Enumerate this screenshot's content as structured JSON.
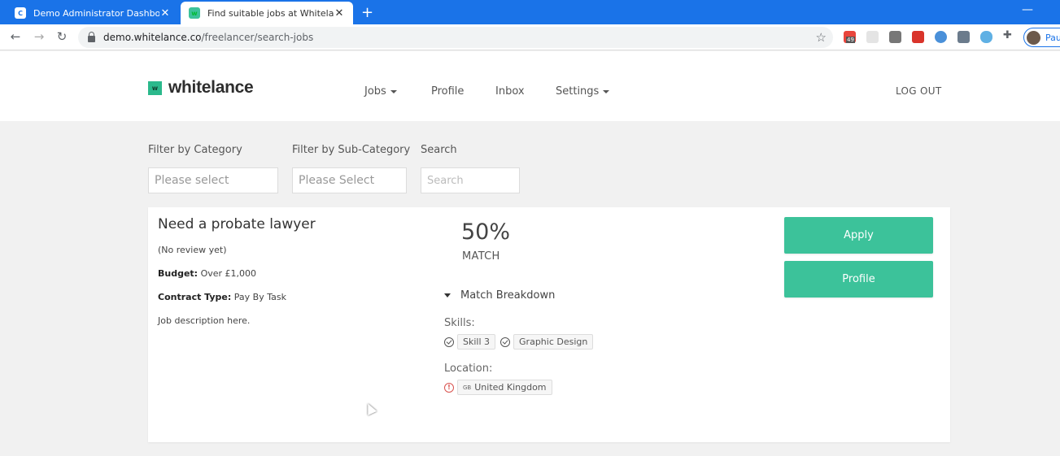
{
  "browser": {
    "tabs": [
      {
        "title": "Demo Administrator Dashboard",
        "favicon": "C"
      },
      {
        "title": "Find suitable jobs at Whitelance.",
        "favicon": "w"
      }
    ],
    "url_host": "demo.whitelance.co",
    "url_path": "/freelancer/search-jobs",
    "profile_name": "Pau",
    "extension_badge": "49"
  },
  "header": {
    "logo_mark": "w",
    "logo_text": "whitelance",
    "nav": {
      "jobs": "Jobs",
      "profile": "Profile",
      "inbox": "Inbox",
      "settings": "Settings"
    },
    "logout": "LOG OUT"
  },
  "filters": {
    "category": {
      "label": "Filter by Category",
      "placeholder": "Please select"
    },
    "subcategory": {
      "label": "Filter by Sub-Category",
      "placeholder": "Please Select"
    },
    "search": {
      "label": "Search",
      "placeholder": "Search"
    }
  },
  "job": {
    "title": "Need a probate lawyer",
    "reviews": "(No review yet)",
    "budget_label": "Budget:",
    "budget_value": "Over £1,000",
    "contract_label": "Contract Type:",
    "contract_value": "Pay By Task",
    "description": "Job description here.",
    "match_percent": "50%",
    "match_label": "MATCH",
    "breakdown_label": "Match Breakdown",
    "skills_label": "Skills:",
    "skills": [
      "Skill 3",
      "Graphic Design"
    ],
    "location_label": "Location:",
    "location_flag": "GB",
    "location": "United Kingdom",
    "apply_label": "Apply",
    "profile_label": "Profile"
  },
  "colors": {
    "accent": "#3cc29a",
    "browser_blue": "#1a73e8",
    "warning": "#d9534f"
  }
}
